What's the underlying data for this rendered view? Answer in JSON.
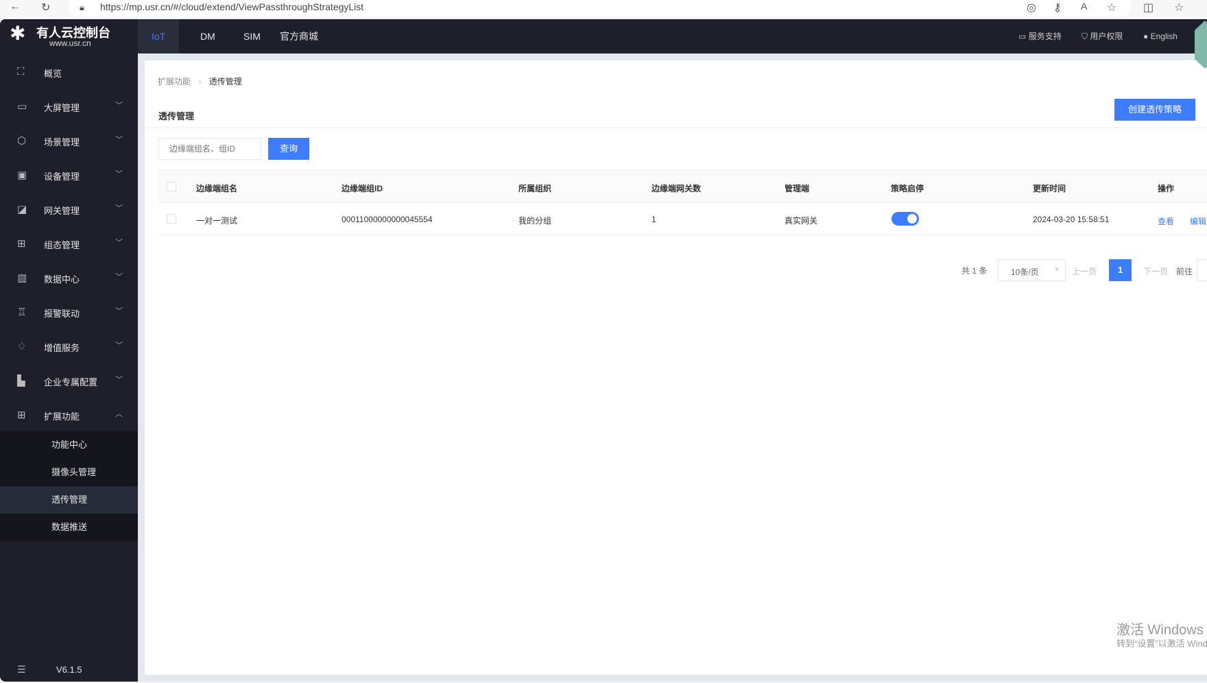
{
  "browser": {
    "url": "https://mp.usr.cn/#/cloud/extend/ViewPassthroughStrategyList"
  },
  "logo": {
    "title": "有人云控制台",
    "subtitle": "www.usr.cn"
  },
  "topnav": {
    "tabs": [
      {
        "label": "IoT",
        "active": true
      },
      {
        "label": "DM"
      },
      {
        "label": "SIM"
      },
      {
        "label": "官方商城"
      }
    ],
    "links": [
      {
        "label": "服务支持",
        "icon": "chat-icon"
      },
      {
        "label": "用户权限",
        "icon": "shield-icon"
      },
      {
        "label": "English",
        "icon": "globe-icon"
      }
    ]
  },
  "sidebar": {
    "items": [
      {
        "label": "概览",
        "icon": "overview-icon"
      },
      {
        "label": "大屏管理",
        "icon": "screen-icon"
      },
      {
        "label": "场景管理",
        "icon": "cube-icon"
      },
      {
        "label": "设备管理",
        "icon": "device-icon"
      },
      {
        "label": "网关管理",
        "icon": "gateway-icon"
      },
      {
        "label": "组态管理",
        "icon": "config-icon"
      },
      {
        "label": "数据中心",
        "icon": "chart-icon"
      },
      {
        "label": "报警联动",
        "icon": "alarm-icon"
      },
      {
        "label": "增值服务",
        "icon": "diamond-icon"
      },
      {
        "label": "企业专属配置",
        "icon": "enterprise-icon"
      },
      {
        "label": "扩展功能",
        "icon": "grid-icon",
        "expanded": true
      }
    ],
    "subitems": [
      {
        "label": "功能中心"
      },
      {
        "label": "摄像头管理"
      },
      {
        "label": "透传管理",
        "active": true
      },
      {
        "label": "数据推送"
      }
    ],
    "version": "V6.1.5"
  },
  "breadcrumb": [
    "扩展功能",
    "透传管理"
  ],
  "page": {
    "title": "透传管理",
    "create_button": "创建透传策略",
    "search_placeholder": "边缘端组名、组ID",
    "query_button": "查询"
  },
  "table": {
    "headers": [
      "边缘端组名",
      "边缘端组ID",
      "所属组织",
      "边缘端网关数",
      "管理端",
      "策略启停",
      "更新时间",
      "操作"
    ],
    "rows": [
      {
        "name": "一对一测试",
        "id": "00011000000000045554",
        "org": "我的分组",
        "count": "1",
        "manager": "真实网关",
        "enabled": true,
        "updated": "2024-03-20 15:58:51",
        "actions": [
          "查看",
          "编辑"
        ]
      }
    ]
  },
  "pagination": {
    "total": "共 1 条",
    "page_size": "10条/页",
    "prev": "上一页",
    "current": "1",
    "next": "下一页",
    "goto": "前往"
  },
  "watermark": {
    "line1": "激活 Windows",
    "line2": "转到“设置”以激活 Windows。"
  },
  "colors": {
    "accent": "#3d7bff",
    "nav_bg": "#1d202a"
  }
}
